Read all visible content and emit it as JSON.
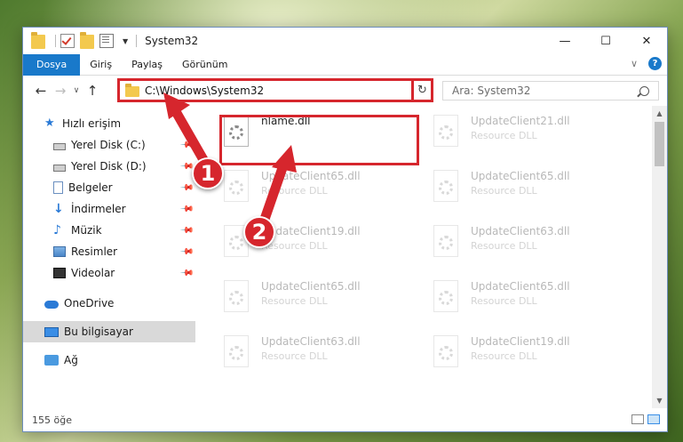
{
  "window": {
    "title": "System32",
    "minimize": "—",
    "maximize": "☐",
    "close": "✕"
  },
  "ribbon": {
    "tabs": [
      {
        "label": "Dosya",
        "active": true
      },
      {
        "label": "Giriş"
      },
      {
        "label": "Paylaş"
      },
      {
        "label": "Görünüm"
      }
    ],
    "help": "?"
  },
  "nav": {
    "back": "←",
    "forward": "→",
    "recent": "∨",
    "up": "↑",
    "address": "C:\\Windows\\System32",
    "search_placeholder": "Ara: System32"
  },
  "sidebar": {
    "items": [
      {
        "label": "Hızlı erişim",
        "icon": "star-icon"
      },
      {
        "label": "Yerel Disk (C:)",
        "icon": "drive-icon",
        "pinned": true
      },
      {
        "label": "Yerel Disk (D:)",
        "icon": "drive-icon",
        "pinned": true
      },
      {
        "label": "Belgeler",
        "icon": "document-icon",
        "pinned": true
      },
      {
        "label": "İndirmeler",
        "icon": "download-icon",
        "pinned": true
      },
      {
        "label": "Müzik",
        "icon": "music-icon",
        "pinned": true
      },
      {
        "label": "Resimler",
        "icon": "pictures-icon",
        "pinned": true
      },
      {
        "label": "Videolar",
        "icon": "video-icon",
        "pinned": true
      },
      {
        "label": "OneDrive",
        "icon": "cloud-icon"
      },
      {
        "label": "Bu bilgisayar",
        "icon": "computer-icon",
        "selected": true
      },
      {
        "label": "Ağ",
        "icon": "network-icon"
      }
    ]
  },
  "files": [
    {
      "name": "nlame.dll",
      "type": "",
      "highlighted": true
    },
    {
      "name": "UpdateClient21.dll",
      "type": "Resource DLL"
    },
    {
      "name": "UpdateClient65.dll",
      "type": "Resource DLL"
    },
    {
      "name": "UpdateClient65.dll",
      "type": "Resource DLL"
    },
    {
      "name": "UpdateClient19.dll",
      "type": "Resource DLL"
    },
    {
      "name": "UpdateClient63.dll",
      "type": "Resource DLL"
    },
    {
      "name": "UpdateClient65.dll",
      "type": "Resource DLL"
    },
    {
      "name": "UpdateClient65.dll",
      "type": "Resource DLL"
    },
    {
      "name": "UpdateClient63.dll",
      "type": "Resource DLL"
    },
    {
      "name": "UpdateClient19.dll",
      "type": "Resource DLL"
    }
  ],
  "status": {
    "count": "155 öğe"
  },
  "annotations": {
    "step1": "1",
    "step2": "2",
    "color": "#d6262d"
  }
}
